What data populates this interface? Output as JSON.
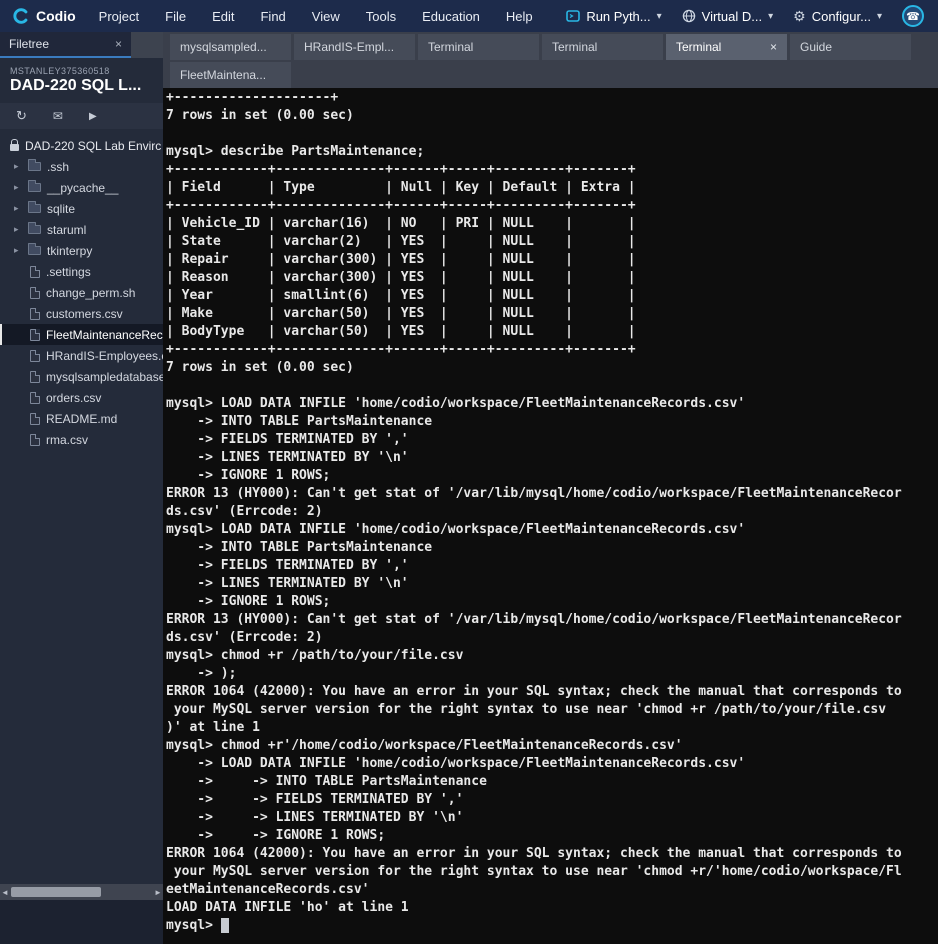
{
  "topbar": {
    "logo_label": "Codio",
    "menus": [
      "Project",
      "File",
      "Edit",
      "Find",
      "View",
      "Tools",
      "Education",
      "Help"
    ],
    "buttons": [
      {
        "label": "Run Pyth...",
        "caret": "▾"
      },
      {
        "label": "Virtual D...",
        "caret": "▾"
      },
      {
        "label": "Configur...",
        "caret": "▾"
      }
    ],
    "phone_glyph": "☎",
    "gear_glyph": "⚙"
  },
  "sidebar": {
    "tab_label": "Filetree",
    "tab_close": "×",
    "account": "MSTANLEY375360518",
    "project": "DAD-220 SQL L...",
    "toolbar": {
      "refresh_glyph": "↻",
      "mail_glyph": "✉",
      "play_glyph": "▶"
    },
    "tree": [
      {
        "label": "DAD-220 SQL Lab Envirc",
        "type": "root"
      },
      {
        "label": ".ssh",
        "type": "folder"
      },
      {
        "label": "__pycache__",
        "type": "folder"
      },
      {
        "label": "sqlite",
        "type": "folder"
      },
      {
        "label": "staruml",
        "type": "folder"
      },
      {
        "label": "tkinterpy",
        "type": "folder"
      },
      {
        "label": ".settings",
        "type": "file"
      },
      {
        "label": "change_perm.sh",
        "type": "file"
      },
      {
        "label": "customers.csv",
        "type": "file"
      },
      {
        "label": "FleetMaintenanceRec",
        "type": "file",
        "selected": true
      },
      {
        "label": "HRandIS-Employees.c",
        "type": "file"
      },
      {
        "label": "mysqlsampledatabase",
        "type": "file"
      },
      {
        "label": "orders.csv",
        "type": "file"
      },
      {
        "label": "README.md",
        "type": "file"
      },
      {
        "label": "rma.csv",
        "type": "file"
      }
    ],
    "scroll": {
      "left_arrow": "◄",
      "right_arrow": "►"
    }
  },
  "tabs": {
    "row1": [
      {
        "label": "mysqlsampled..."
      },
      {
        "label": "HRandIS-Empl..."
      },
      {
        "label": "Terminal"
      },
      {
        "label": "Terminal"
      },
      {
        "label": "Terminal",
        "active": true,
        "close": "×"
      },
      {
        "label": "Guide"
      }
    ],
    "row2": [
      {
        "label": "FleetMaintena..."
      }
    ]
  },
  "terminal": {
    "prompt": "mysql> ",
    "lines": [
      "+--------------------+",
      "7 rows in set (0.00 sec)",
      "",
      "mysql> describe PartsMaintenance;",
      "+------------+--------------+------+-----+---------+-------+",
      "| Field      | Type         | Null | Key | Default | Extra |",
      "+------------+--------------+------+-----+---------+-------+",
      "| Vehicle_ID | varchar(16)  | NO   | PRI | NULL    |       |",
      "| State      | varchar(2)   | YES  |     | NULL    |       |",
      "| Repair     | varchar(300) | YES  |     | NULL    |       |",
      "| Reason     | varchar(300) | YES  |     | NULL    |       |",
      "| Year       | smallint(6)  | YES  |     | NULL    |       |",
      "| Make       | varchar(50)  | YES  |     | NULL    |       |",
      "| BodyType   | varchar(50)  | YES  |     | NULL    |       |",
      "+------------+--------------+------+-----+---------+-------+",
      "7 rows in set (0.00 sec)",
      "",
      "mysql> LOAD DATA INFILE 'home/codio/workspace/FleetMaintenanceRecords.csv'",
      "    -> INTO TABLE PartsMaintenance",
      "    -> FIELDS TERMINATED BY ','",
      "    -> LINES TERMINATED BY '\\n'",
      "    -> IGNORE 1 ROWS;",
      "ERROR 13 (HY000): Can't get stat of '/var/lib/mysql/home/codio/workspace/FleetMaintenanceRecor",
      "ds.csv' (Errcode: 2)",
      "mysql> LOAD DATA INFILE 'home/codio/workspace/FleetMaintenanceRecords.csv'",
      "    -> INTO TABLE PartsMaintenance",
      "    -> FIELDS TERMINATED BY ','",
      "    -> LINES TERMINATED BY '\\n'",
      "    -> IGNORE 1 ROWS;",
      "ERROR 13 (HY000): Can't get stat of '/var/lib/mysql/home/codio/workspace/FleetMaintenanceRecor",
      "ds.csv' (Errcode: 2)",
      "mysql> chmod +r /path/to/your/file.csv",
      "    -> );",
      "ERROR 1064 (42000): You have an error in your SQL syntax; check the manual that corresponds to",
      " your MySQL server version for the right syntax to use near 'chmod +r /path/to/your/file.csv",
      ")' at line 1",
      "mysql> chmod +r'/home/codio/workspace/FleetMaintenanceRecords.csv'",
      "    -> LOAD DATA INFILE 'home/codio/workspace/FleetMaintenanceRecords.csv'",
      "    ->     -> INTO TABLE PartsMaintenance",
      "    ->     -> FIELDS TERMINATED BY ','",
      "    ->     -> LINES TERMINATED BY '\\n'",
      "    ->     -> IGNORE 1 ROWS;",
      "ERROR 1064 (42000): You have an error in your SQL syntax; check the manual that corresponds to",
      " your MySQL server version for the right syntax to use near 'chmod +r/'home/codio/workspace/Fl",
      "eetMaintenanceRecords.csv'",
      "LOAD DATA INFILE 'ho' at line 1"
    ]
  },
  "colors": {
    "topbar_bg": "#1d2b4b",
    "accent_cyan": "#29b7e5",
    "sidebar_bg": "#242b3a",
    "tabbar_bg": "#3a3f4b",
    "active_tab_bg": "#5a616f",
    "terminal_bg": "#0d0d0d",
    "terminal_text": "#e9e9e9"
  }
}
